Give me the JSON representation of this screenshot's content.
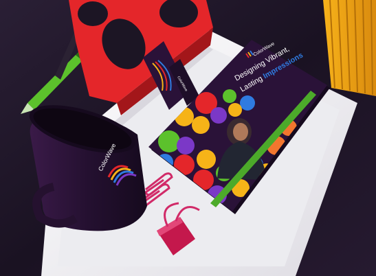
{
  "brand": {
    "name": "ColorWave",
    "notebook_headline_line1": "Designing Vibrant,",
    "notebook_headline_line2_plain": "Lasting ",
    "notebook_headline_line2_accent": "Impressions"
  },
  "colors": {
    "background": "#1c1524",
    "tray": "#f4f3f6",
    "notebook_cover": "#2a1238",
    "elastic_band": "#4caa2a",
    "red_object": "#e4262a",
    "pen_green": "#5cc12c",
    "mug": "#25112f",
    "paper_clip": "#d12a68",
    "binder_clip": "#c4184c",
    "accent_yellow": "#f6b318",
    "accent_blue": "#2f7be0",
    "accent_purple": "#7b38c7",
    "accent_orange": "#f2762e"
  },
  "icons": {
    "logo": "colorwave-wave-logo-icon"
  }
}
